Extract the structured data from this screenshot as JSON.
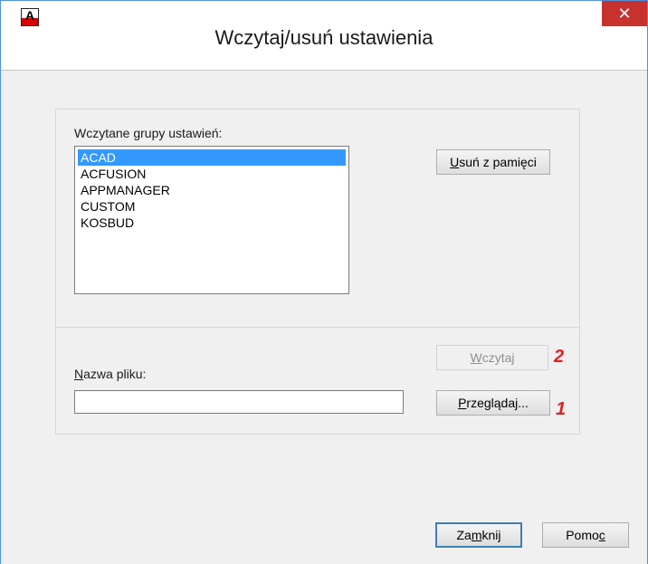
{
  "window": {
    "title": "Wczytaj/usuń ustawienia",
    "close_glyph": "✕"
  },
  "loaded_groups": {
    "label": "Wczytane grupy ustawień:",
    "items": [
      {
        "label": "ACAD",
        "selected": true
      },
      {
        "label": "ACFUSION",
        "selected": false
      },
      {
        "label": "APPMANAGER",
        "selected": false
      },
      {
        "label": "CUSTOM",
        "selected": false
      },
      {
        "label": "KOSBUD",
        "selected": false
      }
    ]
  },
  "buttons": {
    "unload": {
      "access_key": "U",
      "rest": "suń z pamięci"
    },
    "load": {
      "pre": "",
      "access_key": "W",
      "rest": "czytaj",
      "enabled": false
    },
    "browse": {
      "pre": "",
      "access_key": "P",
      "rest": "rzeglądaj..."
    },
    "close": {
      "pre": "Za",
      "access_key": "m",
      "rest": "knij"
    },
    "help": {
      "pre": "Pomo",
      "access_key": "c",
      "rest": ""
    }
  },
  "file_name": {
    "label_access_key": "N",
    "label_rest": "azwa pliku:",
    "value": ""
  },
  "annotations": {
    "load_marker": "2",
    "browse_marker": "1",
    "color": "#e02020"
  },
  "colors": {
    "selection": "#3399ff",
    "close_button": "#c7312e"
  },
  "icons": {
    "app": "autocad-logo-icon",
    "close": "close-icon"
  }
}
